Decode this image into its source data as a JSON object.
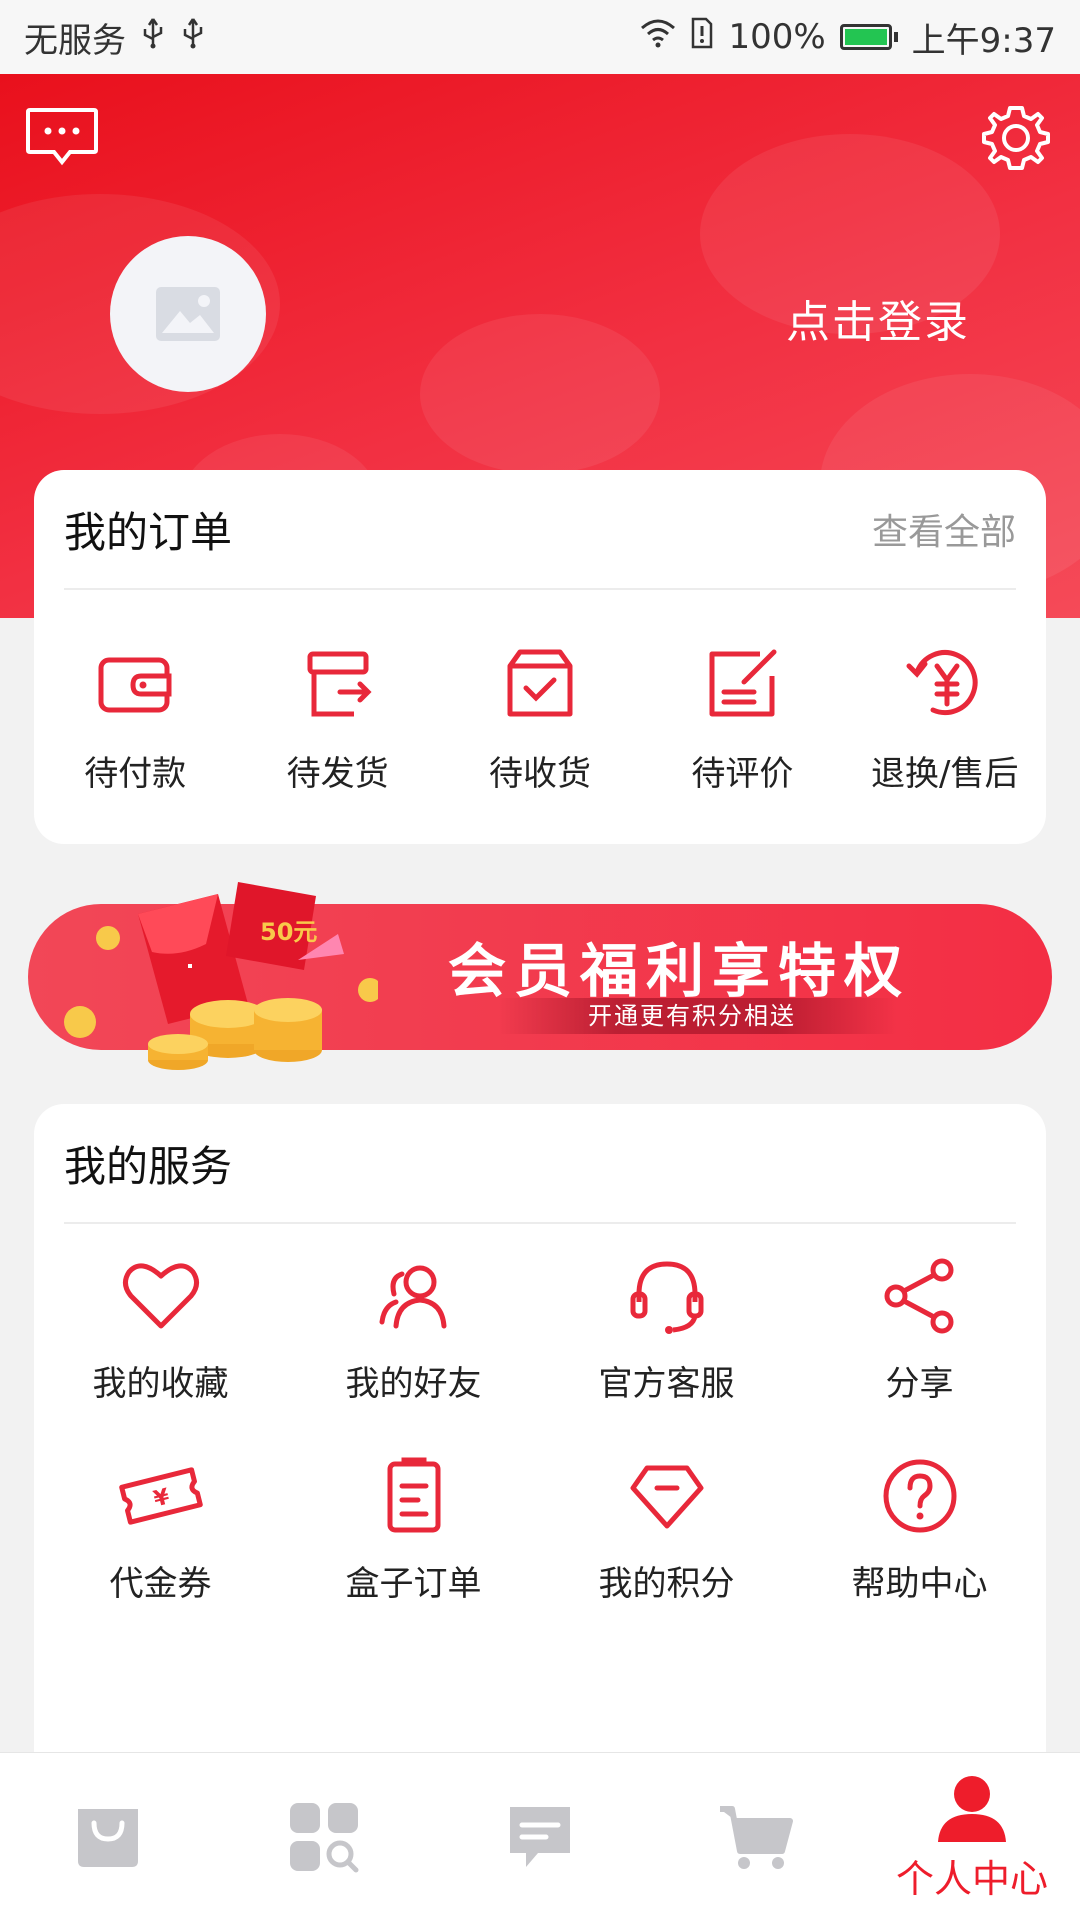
{
  "status_bar": {
    "carrier": "无服务",
    "battery": "100%",
    "time": "上午9:37"
  },
  "header": {
    "login_label": "点击登录"
  },
  "orders": {
    "title": "我的订单",
    "view_all": "查看全部",
    "items": [
      {
        "label": "待付款",
        "icon": "wallet-icon"
      },
      {
        "label": "待发货",
        "icon": "box-arrow-icon"
      },
      {
        "label": "待收货",
        "icon": "package-check-icon"
      },
      {
        "label": "待评价",
        "icon": "edit-note-icon"
      },
      {
        "label": "退换/售后",
        "icon": "refund-yen-icon"
      }
    ]
  },
  "promo": {
    "title": "会员福利享特权",
    "subtitle": "开通更有积分相送",
    "coupon_text": "50元"
  },
  "services": {
    "title": "我的服务",
    "items": [
      {
        "label": "我的收藏",
        "icon": "heart-icon"
      },
      {
        "label": "我的好友",
        "icon": "friends-icon"
      },
      {
        "label": "官方客服",
        "icon": "headset-icon"
      },
      {
        "label": "分享",
        "icon": "share-icon"
      },
      {
        "label": "代金券",
        "icon": "ticket-icon"
      },
      {
        "label": "盒子订单",
        "icon": "clipboard-icon"
      },
      {
        "label": "我的积分",
        "icon": "gem-icon"
      },
      {
        "label": "帮助中心",
        "icon": "help-icon"
      }
    ]
  },
  "bottom_nav": {
    "active": "个人中心",
    "items": [
      {
        "icon": "bag-icon"
      },
      {
        "icon": "category-search-icon"
      },
      {
        "icon": "chat-icon"
      },
      {
        "icon": "cart-icon"
      },
      {
        "icon": "person-icon",
        "label": "个人中心"
      }
    ]
  },
  "colors": {
    "primary": "#ee1d2b",
    "icon_red": "#e8283a",
    "nav_inactive": "#c6c6ca"
  }
}
